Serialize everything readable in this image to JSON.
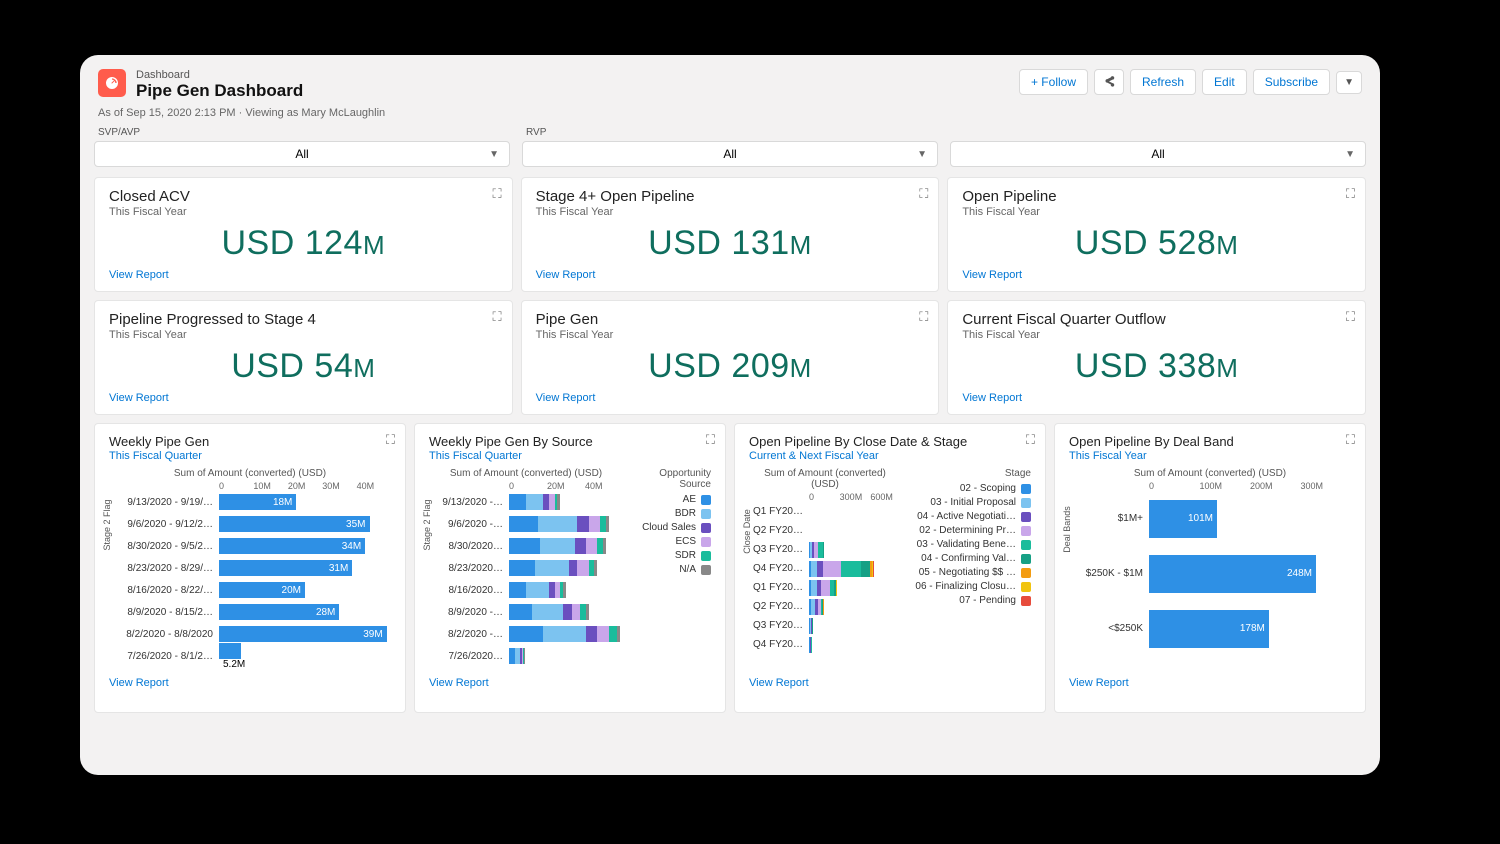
{
  "header": {
    "sup": "Dashboard",
    "title": "Pipe Gen Dashboard",
    "follow": "+  Follow",
    "refresh": "Refresh",
    "edit": "Edit",
    "subscribe": "Subscribe"
  },
  "meta": "As of Sep 15, 2020 2:13 PM · Viewing as Mary McLaughlin",
  "filters": {
    "f1_label": "SVP/AVP",
    "f2_label": "RVP",
    "f1_value": "All",
    "f2_value": "All",
    "f3_value": "All"
  },
  "view_report": "View Report",
  "metrics": [
    {
      "title": "Closed ACV",
      "sub": "This Fiscal Year",
      "value": "USD 124",
      "unit": "M"
    },
    {
      "title": "Stage 4+ Open Pipeline",
      "sub": "This Fiscal Year",
      "value": "USD 131",
      "unit": "M"
    },
    {
      "title": "Open Pipeline",
      "sub": "This Fiscal Year",
      "value": "USD 528",
      "unit": "M"
    },
    {
      "title": "Pipeline Progressed to Stage 4",
      "sub": "This Fiscal Year",
      "value": "USD 54",
      "unit": "M"
    },
    {
      "title": "Pipe Gen",
      "sub": "This Fiscal Year",
      "value": "USD 209",
      "unit": "M"
    },
    {
      "title": "Current Fiscal Quarter Outflow",
      "sub": "This Fiscal Year",
      "value": "USD 338",
      "unit": "M"
    }
  ],
  "chart_titles": {
    "c1": "Weekly Pipe Gen",
    "c1s": "This Fiscal Quarter",
    "c2": "Weekly Pipe Gen By Source",
    "c2s": "This Fiscal Quarter",
    "c3": "Open Pipeline By Close Date & Stage",
    "c3s": "Current & Next Fiscal Year",
    "c4": "Open Pipeline By Deal Band",
    "c4s": "This Fiscal Year"
  },
  "axis_labels": {
    "sum_amount": "Sum of Amount (converted) (USD)",
    "stage2": "Stage 2 Flag",
    "close_date": "Close Date",
    "deal_bands": "Deal Bands",
    "opp_source": "Opportunity Source",
    "stage": "Stage"
  },
  "chart_data": [
    {
      "id": "weekly_pipe_gen",
      "type": "bar",
      "orientation": "horizontal",
      "xlabel": "Sum of Amount (converted) (USD)",
      "ylabel": "Stage 2 Flag",
      "xticks": [
        "0",
        "10M",
        "20M",
        "30M",
        "40M"
      ],
      "xlim": [
        0,
        40
      ],
      "categories": [
        "9/13/2020 - 9/19/…",
        "9/6/2020 - 9/12/2…",
        "8/30/2020 - 9/5/2…",
        "8/23/2020 - 8/29/…",
        "8/16/2020 - 8/22/…",
        "8/9/2020 - 8/15/2…",
        "8/2/2020 - 8/8/2020",
        "7/26/2020 - 8/1/2…"
      ],
      "values": [
        18,
        35,
        34,
        31,
        20,
        28,
        39,
        5.2
      ],
      "value_labels": [
        "18M",
        "35M",
        "34M",
        "31M",
        "20M",
        "28M",
        "39M",
        "5.2M"
      ]
    },
    {
      "id": "weekly_pipe_gen_by_source",
      "type": "bar",
      "orientation": "horizontal",
      "stacked": true,
      "xlabel": "Sum of Amount (converted) (USD)",
      "ylabel": "Stage 2 Flag",
      "xticks": [
        "0",
        "20M",
        "40M"
      ],
      "xlim": [
        0,
        40
      ],
      "legend_title": "Opportunity Source",
      "categories": [
        "9/13/2020 -…",
        "9/6/2020 -…",
        "8/30/2020…",
        "8/23/2020…",
        "8/16/2020…",
        "8/9/2020 -…",
        "8/2/2020 -…",
        "7/26/2020…"
      ],
      "series": [
        {
          "name": "AE",
          "color": "#2e90e5",
          "values": [
            6,
            10,
            11,
            9,
            6,
            8,
            12,
            2
          ]
        },
        {
          "name": "BDR",
          "color": "#7cc3f0",
          "values": [
            6,
            14,
            12,
            12,
            8,
            11,
            15,
            2
          ]
        },
        {
          "name": "Cloud Sales",
          "color": "#6a4fbf",
          "values": [
            2,
            4,
            4,
            3,
            2,
            3,
            4,
            0.5
          ]
        },
        {
          "name": "ECS",
          "color": "#c9a6ea",
          "values": [
            2,
            4,
            4,
            4,
            2,
            3,
            4,
            0.5
          ]
        },
        {
          "name": "SDR",
          "color": "#1abc9c",
          "values": [
            1,
            2,
            2,
            2,
            1,
            2,
            3,
            0.1
          ]
        },
        {
          "name": "N/A",
          "color": "#888",
          "values": [
            1,
            1,
            1,
            1,
            1,
            1,
            1,
            0.1
          ]
        }
      ],
      "legend": [
        "AE",
        "BDR",
        "Cloud Sales",
        "ECS",
        "SDR",
        "N/A"
      ]
    },
    {
      "id": "open_pipeline_by_close_date_stage",
      "type": "bar",
      "orientation": "horizontal",
      "stacked": true,
      "xlabel": "Sum of Amount (converted) (USD)",
      "ylabel": "Close Date",
      "xticks": [
        "0",
        "300M",
        "600M"
      ],
      "xlim": [
        0,
        600
      ],
      "legend_title": "Stage",
      "categories": [
        "Q1 FY20…",
        "Q2 FY20…",
        "Q3 FY20…",
        "Q4 FY20…",
        "Q1 FY20…",
        "Q2 FY20…",
        "Q3 FY20…",
        "Q4 FY20…"
      ],
      "series": [
        {
          "name": "02 - Scoping",
          "color": "#2e90e5",
          "values": [
            0,
            0,
            5,
            10,
            10,
            12,
            8,
            5
          ]
        },
        {
          "name": "03 - Initial Proposal",
          "color": "#7cc3f0",
          "values": [
            0,
            0,
            15,
            40,
            40,
            30,
            6,
            3
          ]
        },
        {
          "name": "04 - Active Negotiati…",
          "color": "#6a4fbf",
          "values": [
            0,
            0,
            10,
            40,
            30,
            15,
            3,
            2
          ]
        },
        {
          "name": "02 - Determining Pr…",
          "color": "#c9a6ea",
          "values": [
            0,
            0,
            30,
            120,
            60,
            20,
            4,
            2
          ]
        },
        {
          "name": "03 - Validating Bene…",
          "color": "#1abc9c",
          "values": [
            0,
            0,
            30,
            130,
            25,
            10,
            2,
            1
          ]
        },
        {
          "name": "04 - Confirming Val…",
          "color": "#16a085",
          "values": [
            0,
            0,
            10,
            60,
            10,
            5,
            1,
            0
          ]
        },
        {
          "name": "05 - Negotiating $$ …",
          "color": "#f39c12",
          "values": [
            0,
            0,
            0,
            10,
            2,
            1,
            0,
            0
          ]
        },
        {
          "name": "06 - Finalizing Closu…",
          "color": "#f1c40f",
          "values": [
            0,
            0,
            0,
            5,
            1,
            0,
            0,
            0
          ]
        },
        {
          "name": "07 - Pending",
          "color": "#e74c3c",
          "values": [
            0,
            0,
            0,
            2,
            0,
            0,
            0,
            0
          ]
        }
      ],
      "legend": [
        "02 - Scoping",
        "03 - Initial Proposal",
        "04 - Active Negotiati…",
        "02 - Determining Pr…",
        "03 - Validating Bene…",
        "04 - Confirming Val…",
        "05 - Negotiating $$ …",
        "06 - Finalizing Closu…",
        "07 - Pending"
      ]
    },
    {
      "id": "open_pipeline_by_deal_band",
      "type": "bar",
      "orientation": "horizontal",
      "xlabel": "Sum of Amount (converted) (USD)",
      "ylabel": "Deal Bands",
      "xticks": [
        "0",
        "100M",
        "200M",
        "300M"
      ],
      "xlim": [
        0,
        300
      ],
      "categories": [
        "$1M+",
        "$250K - $1M",
        "<$250K"
      ],
      "values": [
        101,
        248,
        178
      ],
      "value_labels": [
        "101M",
        "248M",
        "178M"
      ]
    }
  ]
}
